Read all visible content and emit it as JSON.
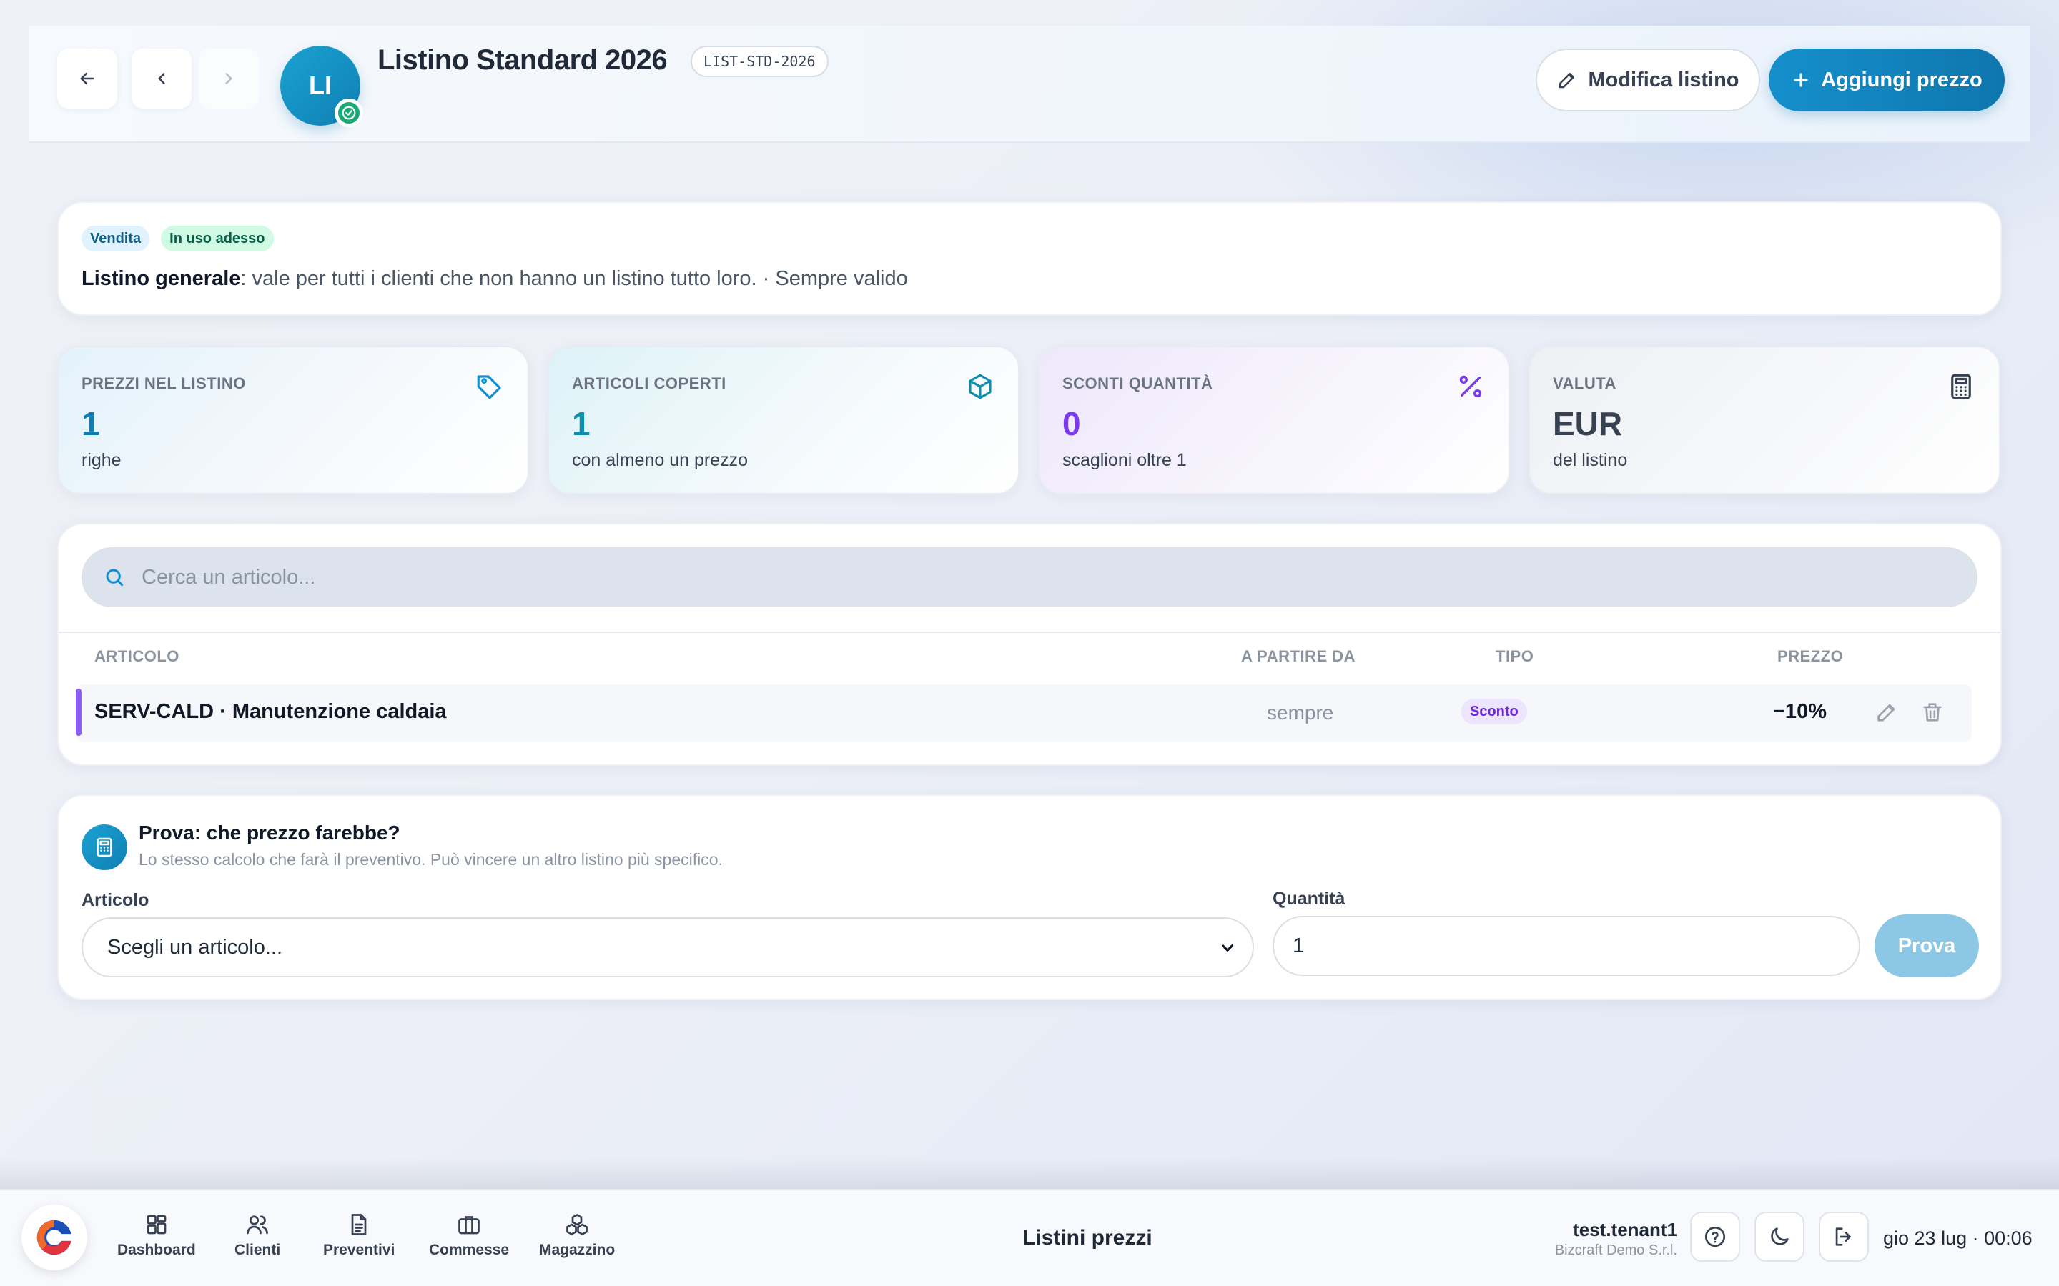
{
  "header": {
    "title": "Listino Standard 2026",
    "code": "LIST-STD-2026",
    "avatar_initials": "LI",
    "edit_label": "Modifica listino",
    "add_label": "Aggiungi prezzo"
  },
  "info": {
    "tag_type": "Vendita",
    "tag_status": "In uso adesso",
    "bold": "Listino generale",
    "text": ": vale per tutti i clienti che non hanno un listino tutto loro. · Sempre valido"
  },
  "stats": [
    {
      "label": "PREZZI NEL LISTINO",
      "value": "1",
      "sub": "righe",
      "icon": "tag-icon",
      "color": "#0f7eb3"
    },
    {
      "label": "ARTICOLI COPERTI",
      "value": "1",
      "sub": "con almeno un prezzo",
      "icon": "box-icon",
      "color": "#0e8fae"
    },
    {
      "label": "SCONTI QUANTITÀ",
      "value": "0",
      "sub": "scaglioni oltre 1",
      "icon": "percent-icon",
      "color": "#7c3aed"
    },
    {
      "label": "VALUTA",
      "value": "EUR",
      "sub": "del listino",
      "icon": "calculator-icon",
      "color": "#374151"
    }
  ],
  "table": {
    "search_placeholder": "Cerca un articolo...",
    "columns": [
      "ARTICOLO",
      "A PARTIRE DA",
      "TIPO",
      "PREZZO"
    ],
    "rows": [
      {
        "article": "SERV-CALD · Manutenzione caldaia",
        "from": "sempre",
        "type": "Sconto",
        "price": "−10%"
      }
    ]
  },
  "try": {
    "title": "Prova: che prezzo farebbe?",
    "subtitle": "Lo stesso calcolo che farà il preventivo. Può vincere un altro listino più specifico.",
    "article_label": "Articolo",
    "article_value": "Scegli un articolo...",
    "qty_label": "Quantità",
    "qty_value": "1",
    "button": "Prova"
  },
  "bottom": {
    "nav": [
      "Dashboard",
      "Clienti",
      "Preventivi",
      "Commesse",
      "Magazzino"
    ],
    "page_title": "Listini prezzi",
    "user": "test.tenant1",
    "company": "Bizcraft Demo S.r.l.",
    "datetime": "gio 23 lug · 00:06"
  }
}
